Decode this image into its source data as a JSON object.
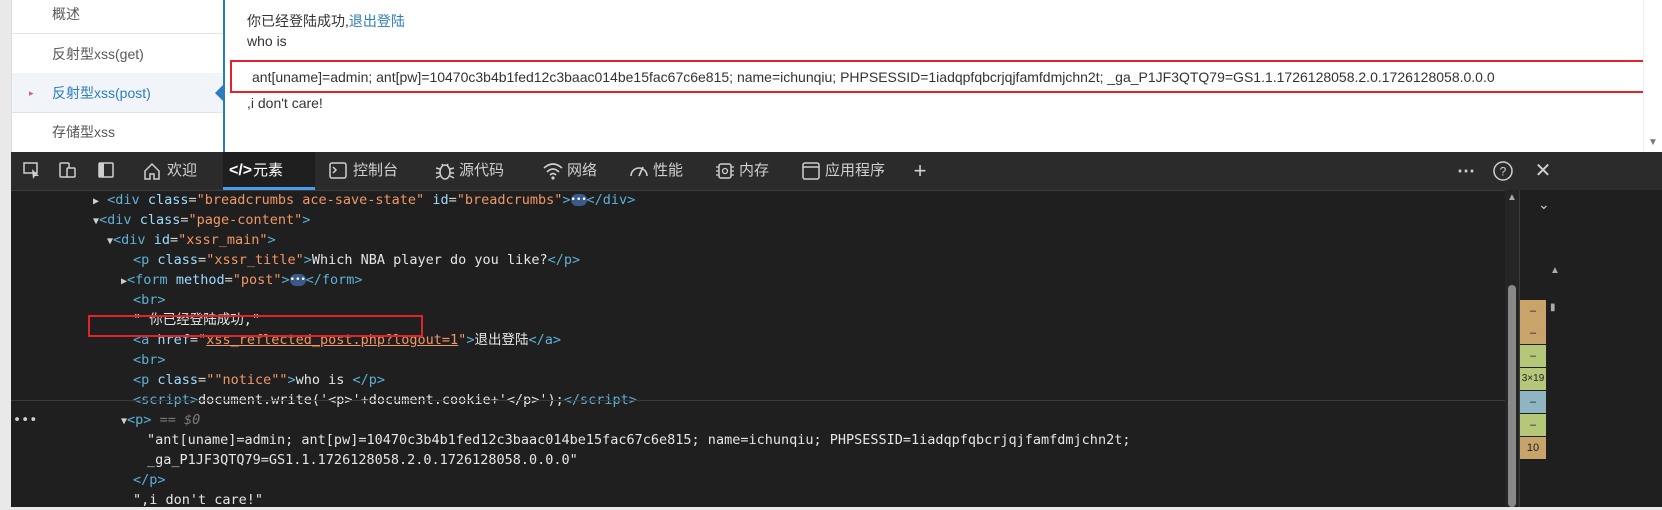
{
  "sidebar": {
    "items": [
      {
        "label": "概述"
      },
      {
        "label": "反射型xss(get)"
      },
      {
        "label": "反射型xss(post)"
      },
      {
        "label": "存储型xss"
      }
    ]
  },
  "content": {
    "login_status": "你已经登陆成功,",
    "logout_link": "退出登陆",
    "who_is": "who is",
    "cookie": "ant[uname]=admin; ant[pw]=10470c3b4b1fed12c3baac014be15fac67c6e815; name=ichunqiu; PHPSESSID=1iadqpfqbcrjqjfamfdmjchn2t; _ga_P1JF3QTQ79=GS1.1.1726128058.2.0.1726128058.0.0.0",
    "dont_care": ",i don't care!"
  },
  "devtools": {
    "tabs": [
      {
        "label": "欢迎",
        "icon": "home-icon"
      },
      {
        "label": "元素",
        "icon": "code-icon"
      },
      {
        "label": "控制台",
        "icon": "console-icon"
      },
      {
        "label": "源代码",
        "icon": "bug-icon"
      },
      {
        "label": "网络",
        "icon": "wifi-icon"
      },
      {
        "label": "性能",
        "icon": "gauge-icon"
      },
      {
        "label": "内存",
        "icon": "chip-icon"
      },
      {
        "label": "应用程序",
        "icon": "app-icon"
      }
    ],
    "code": {
      "l1_attr1_val": "\"breadcrumbs ace-save-state\"",
      "l1_attr2_val": "\"breadcrumbs\"",
      "l2_val": "\"page-content\"",
      "l3_val": "\"xssr_main\"",
      "l4_val": "\"xssr_title\"",
      "l4_text": "Which NBA player do you like?",
      "l5_val": "\"post\"",
      "l7_text": "\" 你已经登陆成功,\"",
      "l8_href": "xss_reflected_post.php?logout=1",
      "l8_text": "退出登陆",
      "l10_val": "\"notice\"",
      "l10_text": "who is ",
      "l11_text": "document.write('<p>'+document.cookie+'</p>');",
      "l12_dim": "== $0",
      "l13_text": "\"ant[uname]=admin; ant[pw]=10470c3b4b1fed12c3baac014be15fac67c6e815; name=ichunqiu; PHPSESSID=1iadqpfqbcrjqjfamfdmjchn2t;",
      "l14_text": "_ga_P1JF3QTQ79=GS1.1.1726128058.2.0.1726128058.0.0.0\"",
      "l16_text": "\",i don't care!\""
    },
    "box_model": [
      "–",
      "–",
      "–",
      "3×19",
      "–",
      "–",
      "10"
    ],
    "box_colors": [
      "#c8a46b",
      "#c8a46b",
      "#b5c87a",
      "#b5c87a",
      "#8fb4c4",
      "#b5c87a",
      "#c8a46b",
      "#c8a46b"
    ]
  }
}
